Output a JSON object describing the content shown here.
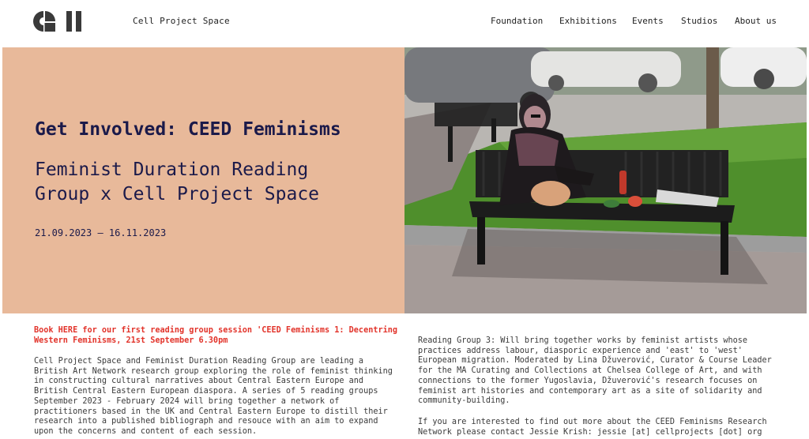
{
  "header": {
    "logo_alt": "cell",
    "site_name": "Cell Project Space",
    "nav": [
      {
        "label": "Foundation"
      },
      {
        "label": "Exhibitions"
      },
      {
        "label": "Events"
      },
      {
        "label": "Studios"
      },
      {
        "label": "About us"
      }
    ]
  },
  "hero": {
    "title": "Get Involved: CEED Feminisms",
    "subtitle_line1": "Feminist Duration Reading",
    "subtitle_line2": "Group x Cell Project Space",
    "dates": "21.09.2023 – 16.11.2023",
    "bg_color": "#e8b99a",
    "title_color": "#1b1a4a"
  },
  "content": {
    "book_link": "Book HERE for our first reading group session 'CEED Feminisms 1: Decentring Western Feminisms, 21st September 6.30pm",
    "intro": "Cell Project Space and Feminist Duration Reading Group are leading a British Art Network research group exploring the role of feminist thinking in constructing cultural narratives about Central Eastern Europe and British Central Eastern European diaspora. A series of 5 reading groups September 2023 - February 2024 will bring together a network of practitioners based in the UK and Central Eastern Europe to distill their research into a published bibliograph and resouce with an aim to expand upon the concerns and content of each session.",
    "reading_group_3": "Reading Group 3: Will bring together works by feminist artists whose practices address labour, diasporic experience and 'east' to 'west' European migration. Moderated by Lina Džuverović, Curator & Course Leader for the MA Curating and Collections at Chelsea College of Art, and with connections to the former Yugoslavia, Džuverović's research focuses on feminist art histories and contemporary art as a site of solidarity and community-building.",
    "contact": "If you are interested to find out more about the CEED Feminisms Research Network please contact Jessie Krish: jessie [at] cellprojects [dot] org",
    "link_color": "#e2332a"
  }
}
